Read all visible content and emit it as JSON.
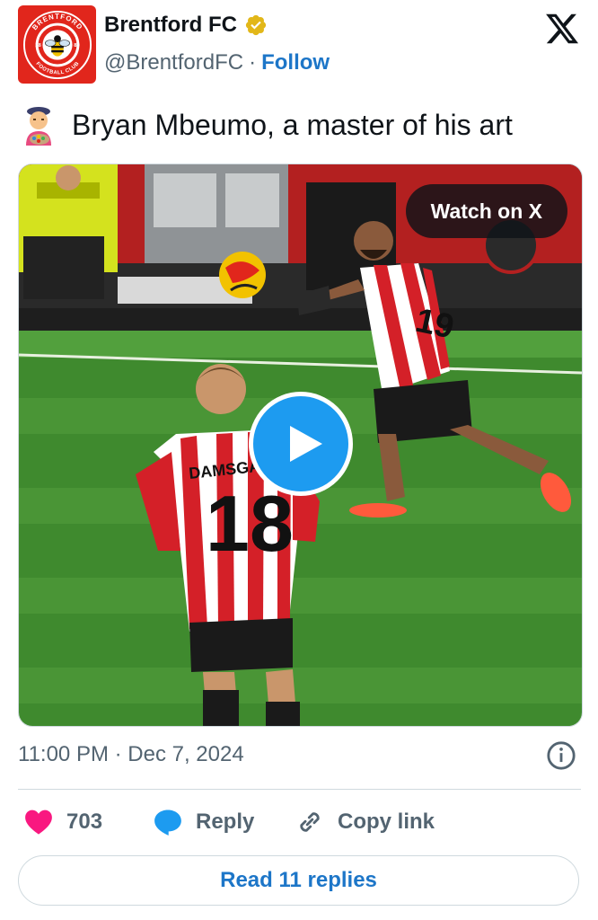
{
  "account": {
    "name": "Brentford FC",
    "handle": "@BrentfordFC",
    "separator": "·",
    "follow_label": "Follow",
    "logo_text_top": "BRENTFORD",
    "logo_text_bottom": "FOOTBALL CLUB",
    "logo_est_left": "18",
    "logo_est_right": "89"
  },
  "tweet": {
    "emoji": "artist-emoji",
    "text": "Bryan Mbeumo, a master of his art"
  },
  "media": {
    "watch_label": "Watch on X",
    "player_front_number": "18",
    "player_front_name": "DAMSGAARD",
    "player_back_number": "19"
  },
  "meta": {
    "timestamp": "11:00 PM · Dec 7, 2024"
  },
  "actions": {
    "like_count": "703",
    "reply_label": "Reply",
    "copy_label": "Copy link"
  },
  "footer": {
    "read_replies_label": "Read 11 replies"
  },
  "colors": {
    "brand_red": "#e1261c",
    "link_blue": "#1d76c8",
    "verified_gold": "#e2b719",
    "like_pink": "#f91880",
    "play_blue": "#1d9bf0"
  }
}
